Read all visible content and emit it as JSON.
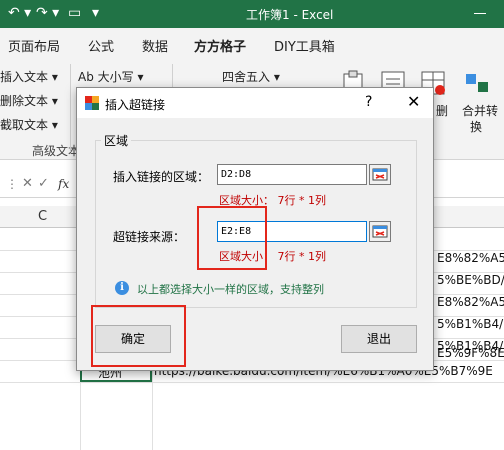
{
  "window": {
    "title": "工作簿1  -  Excel"
  },
  "tabs": [
    {
      "label": "页面布局"
    },
    {
      "label": "公式"
    },
    {
      "label": "数据"
    },
    {
      "label": "方方格子"
    },
    {
      "label": "DIY工具箱"
    }
  ],
  "ribbon": {
    "insert_text": "插入文本 ▾",
    "delete_text": "删除文本 ▾",
    "cut_text": "截取文本 ▾",
    "advanced_text": "高级文本",
    "case": "Ab 大小写 ▾",
    "round": "四舍五入 ▾",
    "merge_convert": "合并转",
    "merge_convert_2": "换",
    "delete_short": "删"
  },
  "formula_bar": {
    "fx": "fx"
  },
  "grid": {
    "col_c": "C",
    "cells": [
      "E8%82%A5/",
      "5%BE%BD/",
      "E8%82%A5/",
      "5%B1%B4/",
      "5%B1%B4/",
      "E5%9F%8E",
      "池州",
      "https://baike.baidu.com/item/%E6%B1%A0%E5%B7%9E"
    ]
  },
  "dialog": {
    "title": "插入超链接",
    "help": "?",
    "close": "✕",
    "group_label": "区域",
    "insert_area_label": "插入链接的区域：",
    "insert_area_value": "D2:D8",
    "insert_area_hint": "区域大小： 7行 * 1列",
    "source_label": "超链接来源：",
    "source_value": "E2:E8",
    "source_hint": "区域大小： 7行 * 1列",
    "info_text": "以上都选择大小一样的区域，支持整列",
    "ok": "确定",
    "exit": "退出"
  },
  "colors": {
    "excel_green": "#217346",
    "hint_red": "#c00000",
    "highlight_red": "#e3261b"
  }
}
